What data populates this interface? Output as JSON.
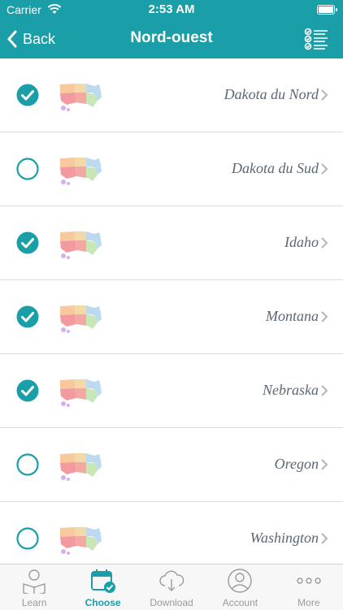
{
  "status": {
    "carrier": "Carrier",
    "time": "2:53 AM"
  },
  "nav": {
    "back_label": "Back",
    "title": "Nord-ouest"
  },
  "rows": [
    {
      "label": "Dakota du Nord",
      "checked": true
    },
    {
      "label": "Dakota du Sud",
      "checked": false
    },
    {
      "label": "Idaho",
      "checked": true
    },
    {
      "label": "Montana",
      "checked": true
    },
    {
      "label": "Nebraska",
      "checked": true
    },
    {
      "label": "Oregon",
      "checked": false
    },
    {
      "label": "Washington",
      "checked": false
    }
  ],
  "tabs": [
    {
      "label": "Learn",
      "active": false
    },
    {
      "label": "Choose",
      "active": true
    },
    {
      "label": "Download",
      "active": false
    },
    {
      "label": "Account",
      "active": false
    },
    {
      "label": "More",
      "active": false
    }
  ],
  "colors": {
    "accent": "#1a9ea8",
    "text": "#5a6775"
  }
}
